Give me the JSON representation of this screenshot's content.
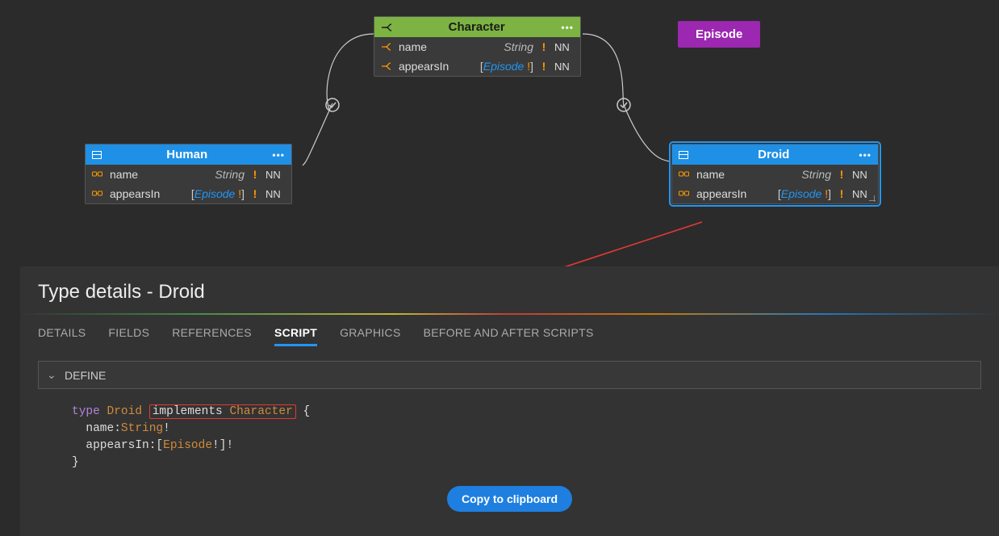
{
  "canvas": {
    "episode_chip": "Episode",
    "nodes": {
      "character": {
        "title": "Character",
        "fields": [
          {
            "name": "name",
            "type_plain": "String",
            "nn": "NN"
          },
          {
            "name": "appearsIn",
            "type_ref": "Episode",
            "list": true,
            "nn": "NN"
          }
        ]
      },
      "human": {
        "title": "Human",
        "fields": [
          {
            "name": "name",
            "type_plain": "String",
            "nn": "NN"
          },
          {
            "name": "appearsIn",
            "type_ref": "Episode",
            "list": true,
            "nn": "NN"
          }
        ]
      },
      "droid": {
        "title": "Droid",
        "fields": [
          {
            "name": "name",
            "type_plain": "String",
            "nn": "NN"
          },
          {
            "name": "appearsIn",
            "type_ref": "Episode",
            "list": true,
            "nn": "NN"
          }
        ]
      }
    }
  },
  "details": {
    "heading": "Type details - Droid",
    "tabs": {
      "details": "DETAILS",
      "fields": "FIELDS",
      "references": "REFERENCES",
      "script": "SCRIPT",
      "graphics": "GRAPHICS",
      "before_after": "BEFORE AND AFTER SCRIPTS"
    },
    "active_tab": "script",
    "section_label": "DEFINE",
    "code": {
      "kw_type": "type",
      "type_name": "Droid",
      "kw_implements": "implements",
      "interface_name": "Character",
      "line_open": " {",
      "line_name": "  name:",
      "t_string": "String",
      "bang1": "!",
      "line_appears": "  appearsIn:[",
      "t_episode": "Episode",
      "bang2": "!]!",
      "line_close": "}"
    },
    "copy_button": "Copy to clipboard"
  }
}
